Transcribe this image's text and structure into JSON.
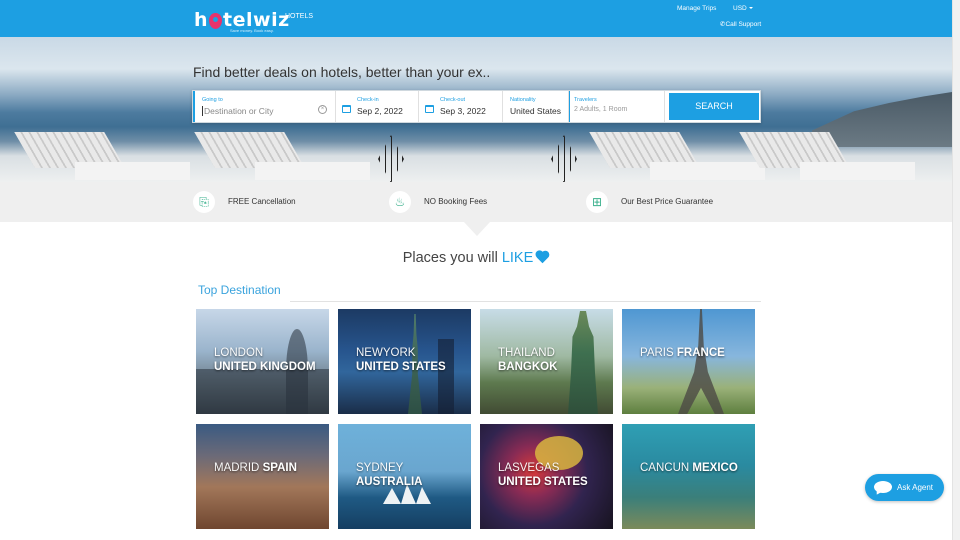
{
  "header": {
    "logo": "hotelwiz",
    "logo_pre": "h",
    "logo_post": "telwiz",
    "tagline": "Save money. Book easy.",
    "nav_hotels": "HOTELS",
    "manage_trips": "Manage Trips",
    "currency": "USD",
    "call_support": "Call Support",
    "brand_color": "#1d9fe2",
    "logo_accent": "#e8326c"
  },
  "hero": {
    "headline": "Find better deals on hotels, better than your ex.."
  },
  "search": {
    "going_to_label": "Going to",
    "going_to_placeholder": "Destination or City",
    "checkin_label": "Check-in",
    "checkin_value": "Sep 2, 2022",
    "checkout_label": "Check-out",
    "checkout_value": "Sep 3, 2022",
    "nationality_label": "Nationality",
    "nationality_value": "United States",
    "travelers_label": "Travelers",
    "travelers_value": "2 Adults, 1 Room",
    "search_button": "SEARCH"
  },
  "features": [
    {
      "icon": "cancellation-icon",
      "text": "FREE Cancellation"
    },
    {
      "icon": "piggy-bank-icon",
      "text": "NO Booking Fees"
    },
    {
      "icon": "gift-icon",
      "text": "Our Best Price Guarantee"
    }
  ],
  "places": {
    "title_prefix": "Places you will",
    "title_highlight": "LIKE",
    "section_title": "Top Destination",
    "destinations": [
      {
        "city": "LONDON",
        "country": "UNITED KINGDOM"
      },
      {
        "city": "NEWYORK",
        "country": "UNITED STATES"
      },
      {
        "city": "THAILAND",
        "country": "BANGKOK"
      },
      {
        "city": "PARIS",
        "country": "FRANCE"
      },
      {
        "city": "MADRID",
        "country": "SPAIN"
      },
      {
        "city": "SYDNEY",
        "country": "AUSTRALIA"
      },
      {
        "city": "LASVEGAS",
        "country": "UNITED STATES"
      },
      {
        "city": "CANCUN",
        "country": "MEXICO"
      }
    ]
  },
  "chat": {
    "ask_agent": "Ask Agent"
  }
}
